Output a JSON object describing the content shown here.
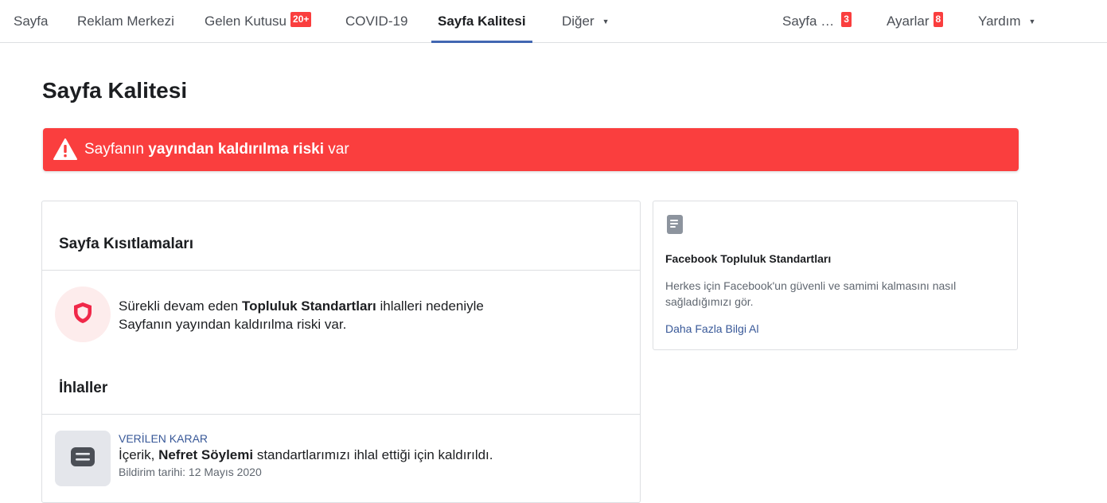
{
  "nav": {
    "items": [
      {
        "label": "Sayfa"
      },
      {
        "label": "Reklam Merkezi"
      },
      {
        "label": "Gelen Kutusu",
        "badge": "20+"
      },
      {
        "label": "COVID-19"
      },
      {
        "label": "Sayfa Kalitesi",
        "active": true
      },
      {
        "label": "Diğer"
      }
    ],
    "right_items": [
      {
        "label": "Sayfa …",
        "badge": "3"
      },
      {
        "label": "Ayarlar",
        "badge": "8"
      },
      {
        "label": "Yardım"
      }
    ]
  },
  "page": {
    "title": "Sayfa Kalitesi"
  },
  "alert": {
    "prefix": "Sayfanın ",
    "bold": "yayından kaldırılma riski",
    "suffix": " var",
    "color": "#fa3e3e"
  },
  "restrictions": {
    "title": "Sayfa Kısıtlamaları",
    "text_prefix": "Sürekli devam eden ",
    "text_bold": "Topluluk Standartları",
    "text_suffix": " ihlalleri nedeniyle",
    "text_line2": "Sayfanın yayından kaldırılma riski var."
  },
  "violations": {
    "title": "İhlaller",
    "items": [
      {
        "verdict": "VERİLEN KARAR",
        "text_prefix": "İçerik, ",
        "text_bold": "Nefret Söylemi",
        "text_suffix": " standartlarımızı ihlal ettiği için kaldırıldı.",
        "date": "Bildirim tarihi: 12 Mayıs 2020"
      }
    ]
  },
  "side_card": {
    "title": "Facebook Topluluk Standartları",
    "description": "Herkes için Facebook'un güvenli ve samimi kalmasını nasıl sağladığımızı gör.",
    "link": "Daha Fazla Bilgi Al"
  },
  "colors": {
    "accent": "#4267b2",
    "danger": "#fa3e3e",
    "link": "#385898"
  }
}
